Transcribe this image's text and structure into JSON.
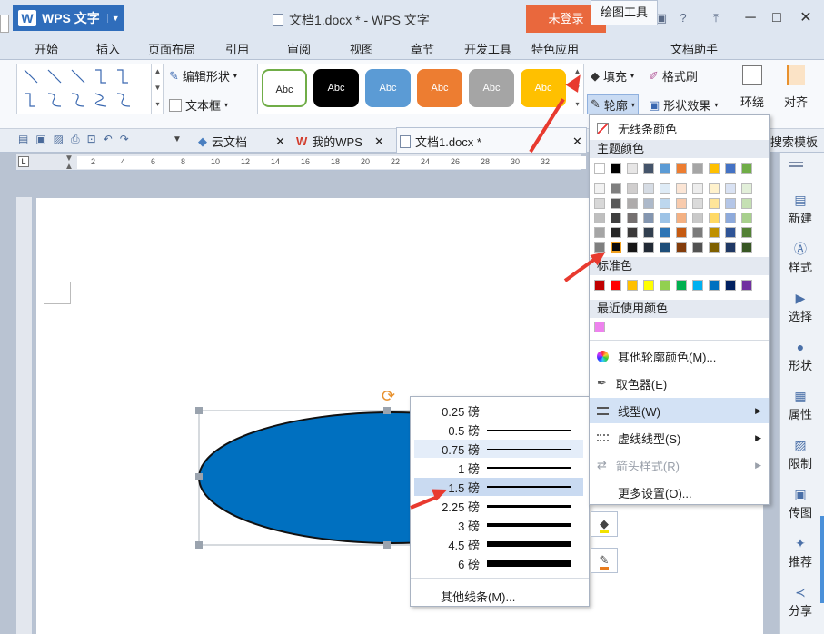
{
  "app": {
    "title": "WPS 文字",
    "window_title": "文档1.docx * - WPS 文字",
    "login": "未登录"
  },
  "menu_tabs": [
    "开始",
    "插入",
    "页面布局",
    "引用",
    "审阅",
    "视图",
    "章节",
    "开发工具",
    "特色应用",
    "绘图工具",
    "文档助手"
  ],
  "ribbon": {
    "edit_shape": "编辑形状",
    "text_box": "文本框",
    "fill": "填充",
    "format_painter": "格式刷",
    "outline": "轮廓",
    "shape_effect": "形状效果",
    "wrap": "环绕",
    "align": "对齐",
    "style_label": "Abc",
    "style_colors": [
      "#ffffff",
      "#000000",
      "#5b9bd5",
      "#ed7d31",
      "#a5a5a5",
      "#ffc000"
    ],
    "right_stub": "搜索模板"
  },
  "doc_tabs": [
    "云文档",
    "我的WPS",
    "文档1.docx *"
  ],
  "ruler_ticks": [
    "2",
    "4",
    "6",
    "8",
    "10",
    "12",
    "14",
    "16",
    "18",
    "20",
    "22",
    "24",
    "26",
    "28",
    "30",
    "32"
  ],
  "sidebar": [
    "新建",
    "样式",
    "选择",
    "形状",
    "属性",
    "限制",
    "传图",
    "推荐",
    "分享"
  ],
  "color_menu": {
    "no_line": "无线条颜色",
    "theme_header": "主题颜色",
    "standard_header": "标准色",
    "recent_header": "最近使用颜色",
    "theme_top": [
      "#ffffff",
      "#000000",
      "#e7e6e6",
      "#44546a",
      "#5b9bd5",
      "#ed7d31",
      "#a5a5a5",
      "#ffc000",
      "#4472c4",
      "#70ad47"
    ],
    "theme_shades": [
      [
        "#f2f2f2",
        "#7f7f7f",
        "#d0cece",
        "#d6dce4",
        "#deebf6",
        "#fbe5d5",
        "#ededed",
        "#fff2cc",
        "#d9e2f3",
        "#e2efd9"
      ],
      [
        "#d8d8d8",
        "#595959",
        "#aeabab",
        "#adb9ca",
        "#bdd7ee",
        "#f8cbad",
        "#dbdbdb",
        "#fee599",
        "#b4c6e7",
        "#c5e0b3"
      ],
      [
        "#bfbfbf",
        "#3f3f3f",
        "#757070",
        "#8496b0",
        "#9dc3e6",
        "#f4b183",
        "#c9c9c9",
        "#ffd965",
        "#8eaadb",
        "#a8d08d"
      ],
      [
        "#a5a5a5",
        "#262626",
        "#3a3838",
        "#323f4f",
        "#2e75b5",
        "#c55a11",
        "#7b7b7b",
        "#bf9000",
        "#2f5496",
        "#538135"
      ],
      [
        "#7f7f7f",
        "#0c0c0c",
        "#171616",
        "#222a35",
        "#1e4e79",
        "#833c0b",
        "#525252",
        "#7f6000",
        "#1f3864",
        "#375623"
      ]
    ],
    "standard": [
      "#c00000",
      "#ff0000",
      "#ffc000",
      "#ffff00",
      "#92d050",
      "#00b050",
      "#00b0f0",
      "#0070c0",
      "#002060",
      "#7030a0"
    ],
    "recent": [
      "#ee82ee"
    ],
    "more_colors": "其他轮廓颜色(M)...",
    "eyedropper": "取色器(E)",
    "line_type": "线型(W)",
    "dash_type": "虚线线型(S)",
    "arrow_style": "箭头样式(R)",
    "more_settings": "更多设置(O)..."
  },
  "line_menu": {
    "weights": [
      {
        "label": "0.25 磅",
        "thickness": 1
      },
      {
        "label": "0.5 磅",
        "thickness": 1
      },
      {
        "label": "0.75 磅",
        "thickness": 1
      },
      {
        "label": "1 磅",
        "thickness": 1.5
      },
      {
        "label": "1.5 磅",
        "thickness": 2
      },
      {
        "label": "2.25 磅",
        "thickness": 3
      },
      {
        "label": "3 磅",
        "thickness": 4
      },
      {
        "label": "4.5 磅",
        "thickness": 6
      },
      {
        "label": "6 磅",
        "thickness": 8
      }
    ],
    "selected_index": 4,
    "other_lines": "其他线条(M)..."
  }
}
